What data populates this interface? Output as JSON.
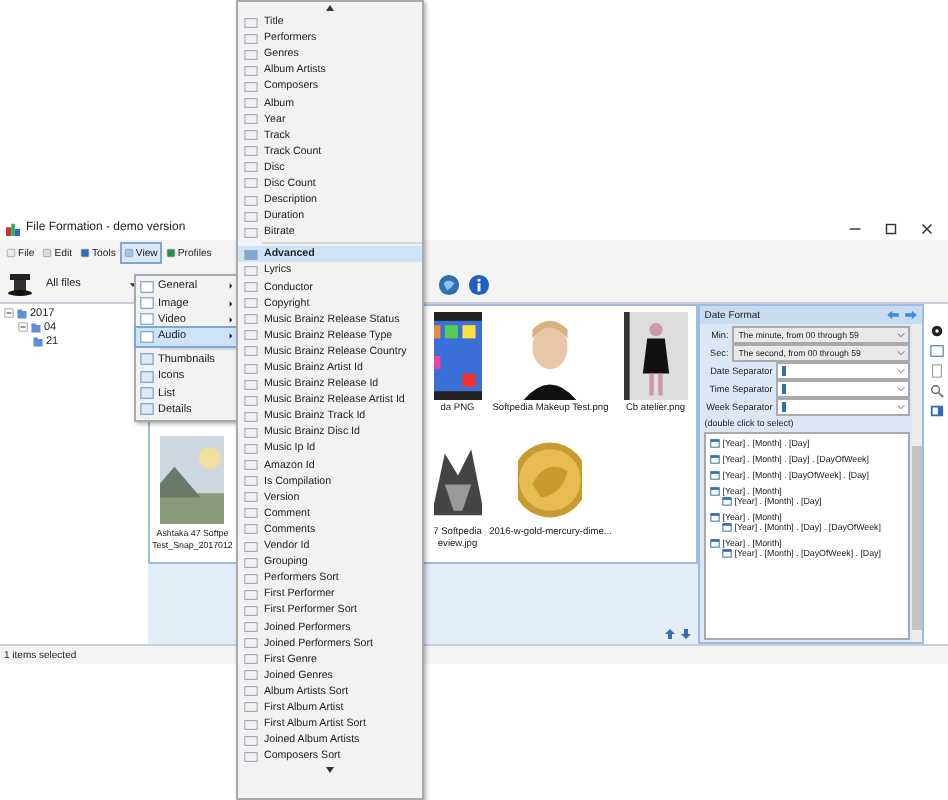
{
  "window": {
    "title": "File Formation - demo version"
  },
  "menubar": [
    {
      "label": "File",
      "selected": false
    },
    {
      "label": "Edit",
      "selected": false
    },
    {
      "label": "Tools",
      "selected": false
    },
    {
      "label": "View",
      "selected": true
    },
    {
      "label": "Profiles",
      "selected": false
    }
  ],
  "toolbar": {
    "filter": "All files"
  },
  "tree": [
    {
      "label": "2017",
      "expanded": true,
      "children": [
        {
          "label": "04",
          "expanded": true,
          "children": [
            {
              "label": "21"
            }
          ]
        }
      ]
    }
  ],
  "view_menu": [
    {
      "label": "General",
      "kind": "submenu",
      "selected": false
    },
    {
      "label": "Image",
      "kind": "submenu",
      "selected": false
    },
    {
      "label": "Video",
      "kind": "submenu",
      "selected": false
    },
    {
      "label": "Audio",
      "kind": "submenu",
      "selected": true
    },
    {
      "label": "Thumbnails",
      "kind": "view",
      "selected": false
    },
    {
      "label": "Icons",
      "kind": "view",
      "selected": false
    },
    {
      "label": "List",
      "kind": "view",
      "selected": false
    },
    {
      "label": "Details",
      "kind": "view",
      "selected": false
    }
  ],
  "audio_menu": [
    {
      "label": "Title",
      "kind": "field",
      "selected": false
    },
    {
      "label": "Performers",
      "kind": "field",
      "selected": false
    },
    {
      "label": "Genres",
      "kind": "field",
      "selected": false
    },
    {
      "label": "Album Artists",
      "kind": "field",
      "selected": false
    },
    {
      "label": "Composers",
      "kind": "field",
      "selected": false
    },
    {
      "label": "Album",
      "kind": "field",
      "selected": false
    },
    {
      "label": "Year",
      "kind": "field",
      "selected": false
    },
    {
      "label": "Track",
      "kind": "field",
      "selected": false
    },
    {
      "label": "Track Count",
      "kind": "field",
      "selected": false
    },
    {
      "label": "Disc",
      "kind": "field",
      "selected": false
    },
    {
      "label": "Disc Count",
      "kind": "field",
      "selected": false
    },
    {
      "label": "Description",
      "kind": "field",
      "selected": false
    },
    {
      "label": "Duration",
      "kind": "field",
      "selected": false
    },
    {
      "label": "Bitrate",
      "kind": "field",
      "selected": false
    },
    {
      "label": "Advanced",
      "kind": "group",
      "selected": true
    },
    {
      "label": "Lyrics",
      "kind": "field",
      "selected": false
    },
    {
      "label": "Conductor",
      "kind": "field",
      "selected": false
    },
    {
      "label": "Copyright",
      "kind": "field",
      "selected": false
    },
    {
      "label": "Music Brainz Release Status",
      "kind": "field",
      "selected": false
    },
    {
      "label": "Music Brainz Release Type",
      "kind": "field",
      "selected": false
    },
    {
      "label": "Music Brainz Release Country",
      "kind": "field",
      "selected": false
    },
    {
      "label": "Music Brainz Artist Id",
      "kind": "field",
      "selected": false
    },
    {
      "label": "Music Brainz Release Id",
      "kind": "field",
      "selected": false
    },
    {
      "label": "Music Brainz Release Artist Id",
      "kind": "field",
      "selected": false
    },
    {
      "label": "Music Brainz Track Id",
      "kind": "field",
      "selected": false
    },
    {
      "label": "Music Brainz Disc Id",
      "kind": "field",
      "selected": false
    },
    {
      "label": "Music Ip Id",
      "kind": "field",
      "selected": false
    },
    {
      "label": "Amazon Id",
      "kind": "field",
      "selected": false
    },
    {
      "label": "Is Compilation",
      "kind": "field",
      "selected": false
    },
    {
      "label": "Version",
      "kind": "field",
      "selected": false
    },
    {
      "label": "Comment",
      "kind": "field",
      "selected": false
    },
    {
      "label": "Comments",
      "kind": "field",
      "selected": false
    },
    {
      "label": "Vendor Id",
      "kind": "field",
      "selected": false
    },
    {
      "label": "Grouping",
      "kind": "field",
      "selected": false
    },
    {
      "label": "Performers Sort",
      "kind": "field",
      "selected": false
    },
    {
      "label": "First Performer",
      "kind": "field",
      "selected": false
    },
    {
      "label": "First Performer Sort",
      "kind": "field",
      "selected": false
    },
    {
      "label": "Joined Performers",
      "kind": "field",
      "selected": false
    },
    {
      "label": "Joined Performers Sort",
      "kind": "field",
      "selected": false
    },
    {
      "label": "First Genre",
      "kind": "field",
      "selected": false
    },
    {
      "label": "Joined Genres",
      "kind": "field",
      "selected": false
    },
    {
      "label": "Album Artists Sort",
      "kind": "field",
      "selected": false
    },
    {
      "label": "First Album Artist",
      "kind": "field",
      "selected": false
    },
    {
      "label": "First Album Artist Sort",
      "kind": "field",
      "selected": false
    },
    {
      "label": "Joined Album Artists",
      "kind": "field",
      "selected": false
    },
    {
      "label": "Composers Sort",
      "kind": "field",
      "selected": false
    }
  ],
  "thumbnails": [
    [
      {
        "caption": [
          "da PNG"
        ]
      },
      {
        "caption": [
          "Softpedia Makeup Test.png"
        ]
      },
      {
        "caption": [
          "Cb atelier.png"
        ]
      }
    ],
    [
      {
        "caption": [
          "Ashtaka 47 Softpe",
          "Test_Snap_2017012"
        ]
      },
      {
        "caption": [
          "7 Softpedia",
          "eview.jpg"
        ]
      },
      {
        "caption": [
          "2016-w-gold-mercury-dime..."
        ]
      }
    ]
  ],
  "date_format": {
    "title": "Date Format",
    "selects": [
      {
        "label": "Min:",
        "value": "The minute, from 00 through 59"
      },
      {
        "label": "Sec:",
        "value": "The second, from 00 through 59"
      }
    ],
    "separators": [
      {
        "label": "Date Separator"
      },
      {
        "label": "Time Separator"
      },
      {
        "label": "Week Separator"
      }
    ],
    "hint": "(double click to select)",
    "formats": [
      {
        "label": "[Year] . [Month] . [Day]"
      },
      {
        "label": "[Year] . [Month] . [Day] . [DayOfWeek]"
      },
      {
        "label": "[Year] . [Month] . [DayOfWeek] . [Day]"
      },
      {
        "label": "[Year] . [Month]",
        "children": [
          {
            "label": "[Year] . [Month] . [Day]"
          }
        ]
      },
      {
        "label": "[Year] . [Month]",
        "children": [
          {
            "label": "[Year] . [Month] . [Day] . [DayOfWeek]"
          }
        ]
      },
      {
        "label": "[Year] . [Month]",
        "children": [
          {
            "label": "[Year] . [Month] . [DayOfWeek] . [Day]"
          }
        ]
      }
    ]
  },
  "status_bar": "1 items selected"
}
